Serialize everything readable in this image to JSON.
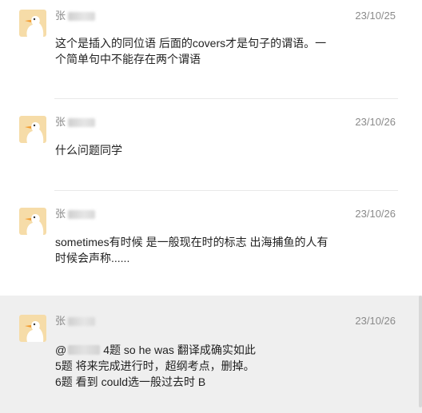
{
  "comments": [
    {
      "name": "张",
      "date": "23/10/25",
      "lines": [
        "这个是插入的同位语 后面的covers才是句子的谓语。一",
        "个简单句中不能存在两个谓语"
      ]
    },
    {
      "name": "张",
      "date": "23/10/26",
      "lines": [
        "什么问题同学"
      ]
    },
    {
      "name": "张",
      "date": "23/10/26",
      "lines": [
        "sometimes有时候 是一般现在时的标志 出海捕鱼的人有",
        "时候会声称......"
      ]
    },
    {
      "name": "张",
      "date": "23/10/26",
      "line1_prefix": "@",
      "line1_rest": "4题 so he was 翻译成确实如此",
      "line2": "5题 将来完成进行时，超纲考点，删掉。",
      "line3": "6题 看到 could选一般过去时 B"
    }
  ],
  "colors": {
    "avatar_bg": "#f6dca8",
    "duck_white": "#ffffff",
    "duck_beak": "#f39a2c",
    "highlight_bg": "#efefef"
  }
}
